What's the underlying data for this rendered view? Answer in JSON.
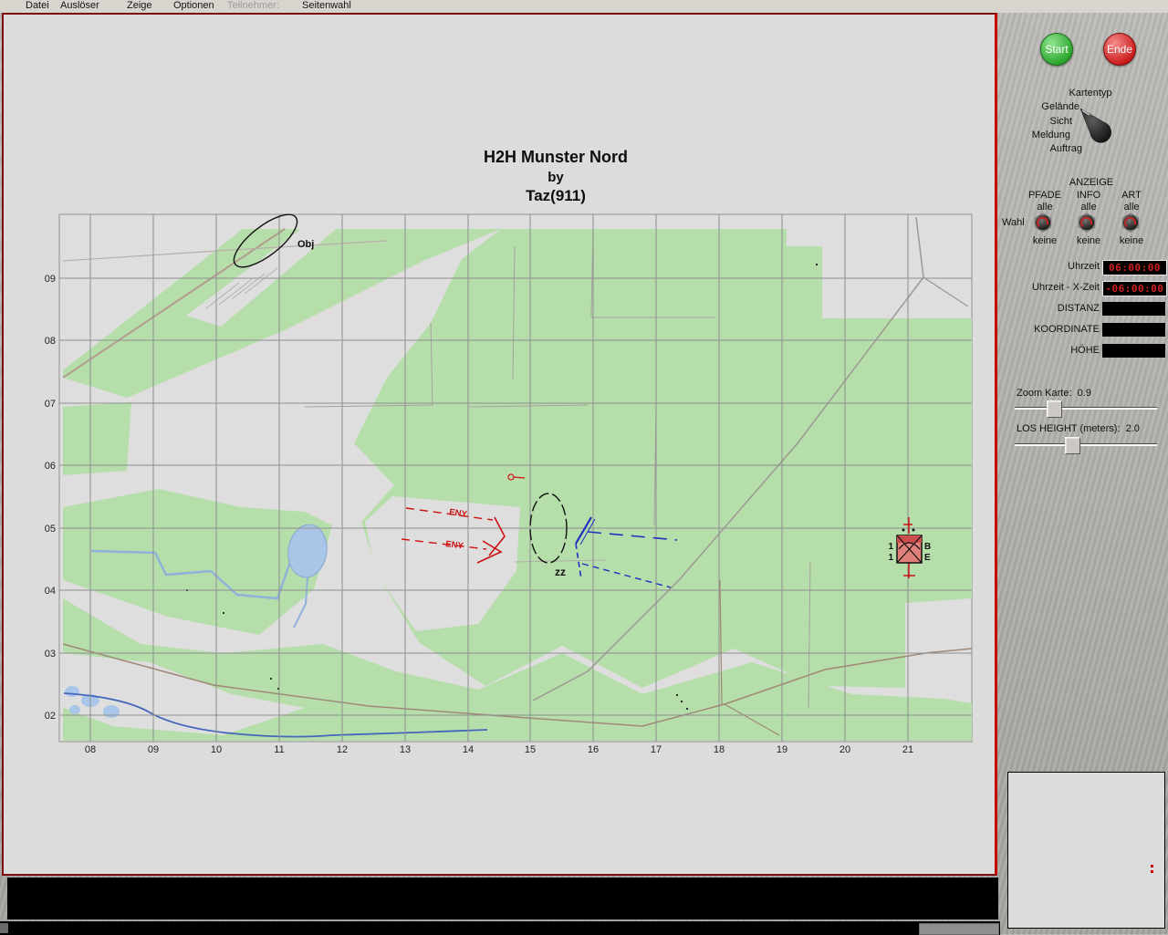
{
  "menu": {
    "items": [
      {
        "label": "Datei"
      },
      {
        "label": "Auslöser"
      },
      {
        "label": "Zeige"
      },
      {
        "label": "Optionen"
      },
      {
        "label": "Teilnehmer:"
      },
      {
        "label": "Seitenwahl"
      }
    ]
  },
  "title": {
    "line1": "H2H Munster Nord",
    "line2": "by",
    "line3": "Taz(911)"
  },
  "map": {
    "x_labels": [
      "08",
      "09",
      "10",
      "11",
      "12",
      "13",
      "14",
      "15",
      "16",
      "17",
      "18",
      "19",
      "20",
      "21"
    ],
    "y_labels": [
      "09",
      "08",
      "07",
      "06",
      "05",
      "04",
      "03",
      "02"
    ],
    "overlays": {
      "objective": "Obj",
      "assembly_area": "zz",
      "enemy_axis_1": "ENY",
      "enemy_axis_2": "ENY",
      "unit": {
        "l1": "1",
        "l2": "1",
        "r1": "B",
        "r2": "E"
      }
    }
  },
  "sidebar": {
    "start": "Start",
    "ende": "Ende",
    "kartentyp": {
      "title": "Kartentyp",
      "options": [
        "Gelände",
        "Sicht",
        "Meldung",
        "Auftrag"
      ],
      "selected": "Gelände"
    },
    "anzeige": {
      "title": "ANZEIGE",
      "wahl": "Wahl",
      "columns": [
        {
          "name": "PFADE",
          "top": "alle",
          "bottom": "keine"
        },
        {
          "name": "INFO",
          "top": "alle",
          "bottom": "keine"
        },
        {
          "name": "ART",
          "top": "alle",
          "bottom": "keine"
        }
      ]
    },
    "readouts": [
      {
        "label": "Uhrzeit",
        "value": "06:00:00"
      },
      {
        "label": "Uhrzeit - X-Zeit",
        "value": "-06:00:00"
      },
      {
        "label": "DISTANZ",
        "value": ""
      },
      {
        "label": "KOORDINATE",
        "value": ""
      },
      {
        "label": "HÖHE",
        "value": ""
      }
    ],
    "zoom_slider": {
      "label": "Zoom Karte:",
      "value": "0.9"
    },
    "los_slider": {
      "label": "LOS HEIGHT (meters):",
      "value": "2.0"
    }
  },
  "colors": {
    "window_border": "#7c0e0e",
    "accent_red": "#c40000",
    "clock_red": "#d42020",
    "forest_green": "#b6deab",
    "water_blue": "#a9c6e8",
    "enemy_red": "#cc1111",
    "friendly_blue": "#2233cc"
  }
}
